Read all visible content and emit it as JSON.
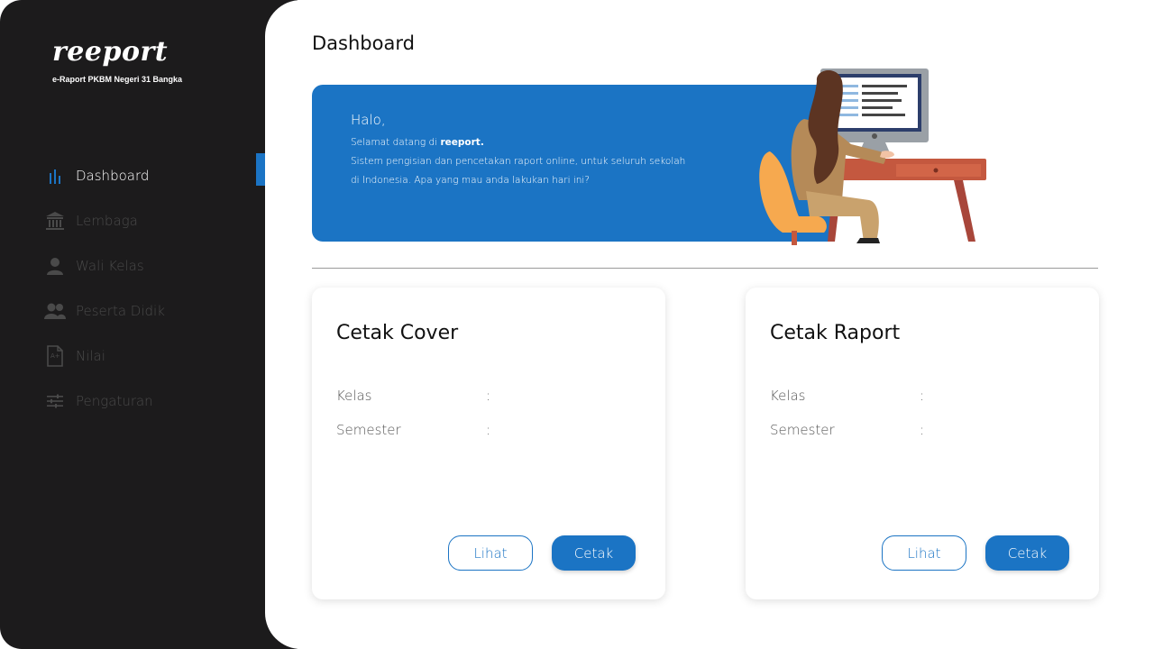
{
  "brand": {
    "logo_text": "reeport",
    "subtitle": "e-Raport PKBM Negeri 31 Bangka"
  },
  "sidebar": {
    "items": [
      {
        "label": "Dashboard",
        "icon": "bar-chart-icon",
        "active": true
      },
      {
        "label": "Lembaga",
        "icon": "institution-icon",
        "active": false
      },
      {
        "label": "Wali Kelas",
        "icon": "user-icon",
        "active": false
      },
      {
        "label": "Peserta Didik",
        "icon": "users-icon",
        "active": false
      },
      {
        "label": "Nilai",
        "icon": "grade-document-icon",
        "active": false
      },
      {
        "label": "Pengaturan",
        "icon": "sliders-icon",
        "active": false
      }
    ]
  },
  "main": {
    "title": "Dashboard",
    "banner": {
      "greeting": "Halo,",
      "welcome_prefix": "Selamat datang di ",
      "welcome_brand": "reeport.",
      "line2": "Sistem pengisian dan pencetakan raport online, untuk seluruh sekolah",
      "line3": "di Indonesia. Apa yang mau anda lakukan hari ini?"
    },
    "cards": [
      {
        "title": "Cetak Cover",
        "fields": [
          {
            "label": "Kelas",
            "separator": ":"
          },
          {
            "label": "Semester",
            "separator": ":"
          }
        ],
        "view_button": "Lihat",
        "print_button": "Cetak"
      },
      {
        "title": "Cetak Raport",
        "fields": [
          {
            "label": "Kelas",
            "separator": ":"
          },
          {
            "label": "Semester",
            "separator": ":"
          }
        ],
        "view_button": "Lihat",
        "print_button": "Cetak"
      }
    ]
  },
  "colors": {
    "sidebar_bg": "#1c1b1c",
    "accent": "#1b74c4",
    "inactive_text": "#4a4a4a"
  }
}
